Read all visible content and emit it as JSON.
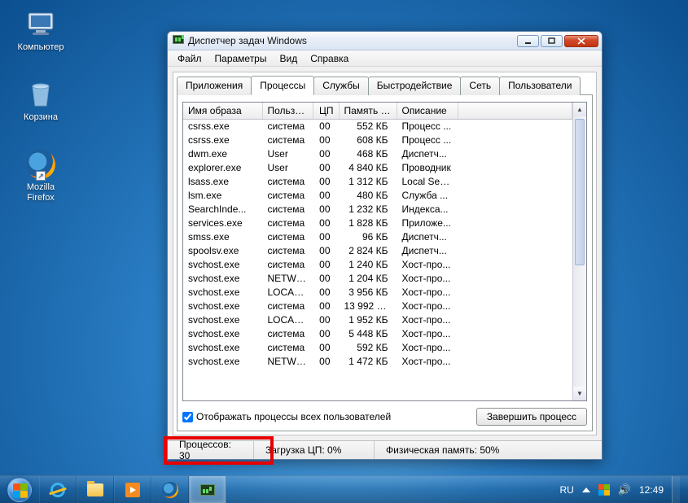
{
  "desktop": {
    "computer": "Компьютер",
    "recycle": "Корзина",
    "firefox": "Mozilla\nFirefox"
  },
  "window": {
    "title": "Диспетчер задач Windows",
    "menu": {
      "file": "Файл",
      "options": "Параметры",
      "view": "Вид",
      "help": "Справка"
    },
    "tabs": {
      "apps": "Приложения",
      "processes": "Процессы",
      "services": "Службы",
      "performance": "Быстродействие",
      "network": "Сеть",
      "users": "Пользователи"
    },
    "columns": {
      "name": "Имя образа",
      "user": "Пользо...",
      "cpu": "ЦП",
      "memory": "Память (...",
      "desc": "Описание"
    },
    "show_all": "Отображать процессы всех пользователей",
    "end_process": "Завершить процесс",
    "status": {
      "processes": "Процессов: 30",
      "cpu": "Загрузка ЦП: 0%",
      "memory": "Физическая память: 50%"
    },
    "rows": [
      {
        "name": "csrss.exe",
        "user": "система",
        "cpu": "00",
        "mem": "552 КБ",
        "desc": "Процесс ..."
      },
      {
        "name": "csrss.exe",
        "user": "система",
        "cpu": "00",
        "mem": "608 КБ",
        "desc": "Процесс ..."
      },
      {
        "name": "dwm.exe",
        "user": "User",
        "cpu": "00",
        "mem": "468 КБ",
        "desc": "Диспетч..."
      },
      {
        "name": "explorer.exe",
        "user": "User",
        "cpu": "00",
        "mem": "4 840 КБ",
        "desc": "Проводник"
      },
      {
        "name": "lsass.exe",
        "user": "система",
        "cpu": "00",
        "mem": "1 312 КБ",
        "desc": "Local Sec..."
      },
      {
        "name": "lsm.exe",
        "user": "система",
        "cpu": "00",
        "mem": "480 КБ",
        "desc": "Служба ..."
      },
      {
        "name": "SearchInde...",
        "user": "система",
        "cpu": "00",
        "mem": "1 232 КБ",
        "desc": "Индекса..."
      },
      {
        "name": "services.exe",
        "user": "система",
        "cpu": "00",
        "mem": "1 828 КБ",
        "desc": "Приложе..."
      },
      {
        "name": "smss.exe",
        "user": "система",
        "cpu": "00",
        "mem": "96 КБ",
        "desc": "Диспетч..."
      },
      {
        "name": "spoolsv.exe",
        "user": "система",
        "cpu": "00",
        "mem": "2 824 КБ",
        "desc": "Диспетч..."
      },
      {
        "name": "svchost.exe",
        "user": "система",
        "cpu": "00",
        "mem": "1 240 КБ",
        "desc": "Хост-про..."
      },
      {
        "name": "svchost.exe",
        "user": "NETWO...",
        "cpu": "00",
        "mem": "1 204 КБ",
        "desc": "Хост-про..."
      },
      {
        "name": "svchost.exe",
        "user": "LOCAL ...",
        "cpu": "00",
        "mem": "3 956 КБ",
        "desc": "Хост-про..."
      },
      {
        "name": "svchost.exe",
        "user": "система",
        "cpu": "00",
        "mem": "13 992 КБ",
        "desc": "Хост-про..."
      },
      {
        "name": "svchost.exe",
        "user": "LOCAL ...",
        "cpu": "00",
        "mem": "1 952 КБ",
        "desc": "Хост-про..."
      },
      {
        "name": "svchost.exe",
        "user": "система",
        "cpu": "00",
        "mem": "5 448 КБ",
        "desc": "Хост-про..."
      },
      {
        "name": "svchost.exe",
        "user": "система",
        "cpu": "00",
        "mem": "592 КБ",
        "desc": "Хост-про..."
      },
      {
        "name": "svchost.exe",
        "user": "NETWO...",
        "cpu": "00",
        "mem": "1 472 КБ",
        "desc": "Хост-про..."
      }
    ]
  },
  "tray": {
    "lang": "RU",
    "time": "12:49"
  }
}
